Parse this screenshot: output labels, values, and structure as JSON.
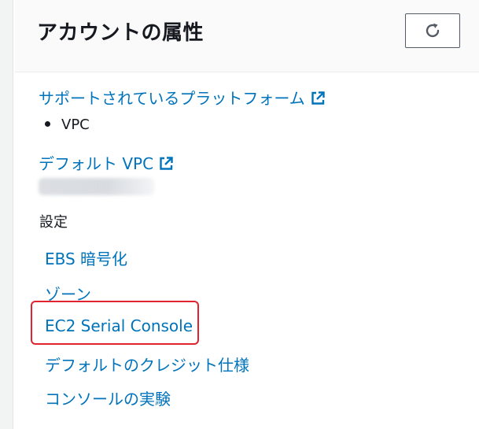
{
  "panel": {
    "title": "アカウントの属性",
    "refresh_icon": "refresh-icon"
  },
  "supported_platforms": {
    "label": "サポートされているプラットフォーム",
    "icon": "external-link-icon",
    "items": [
      "VPC"
    ]
  },
  "default_vpc": {
    "label": "デフォルト VPC",
    "icon": "external-link-icon"
  },
  "settings": {
    "heading": "設定",
    "links": [
      "EBS 暗号化",
      "ゾーン",
      "EC2 Serial Console",
      "デフォルトのクレジット仕様",
      "コンソールの実験"
    ]
  },
  "colors": {
    "link": "#0073bb",
    "highlight": "#e0232e",
    "text": "#16191f"
  }
}
